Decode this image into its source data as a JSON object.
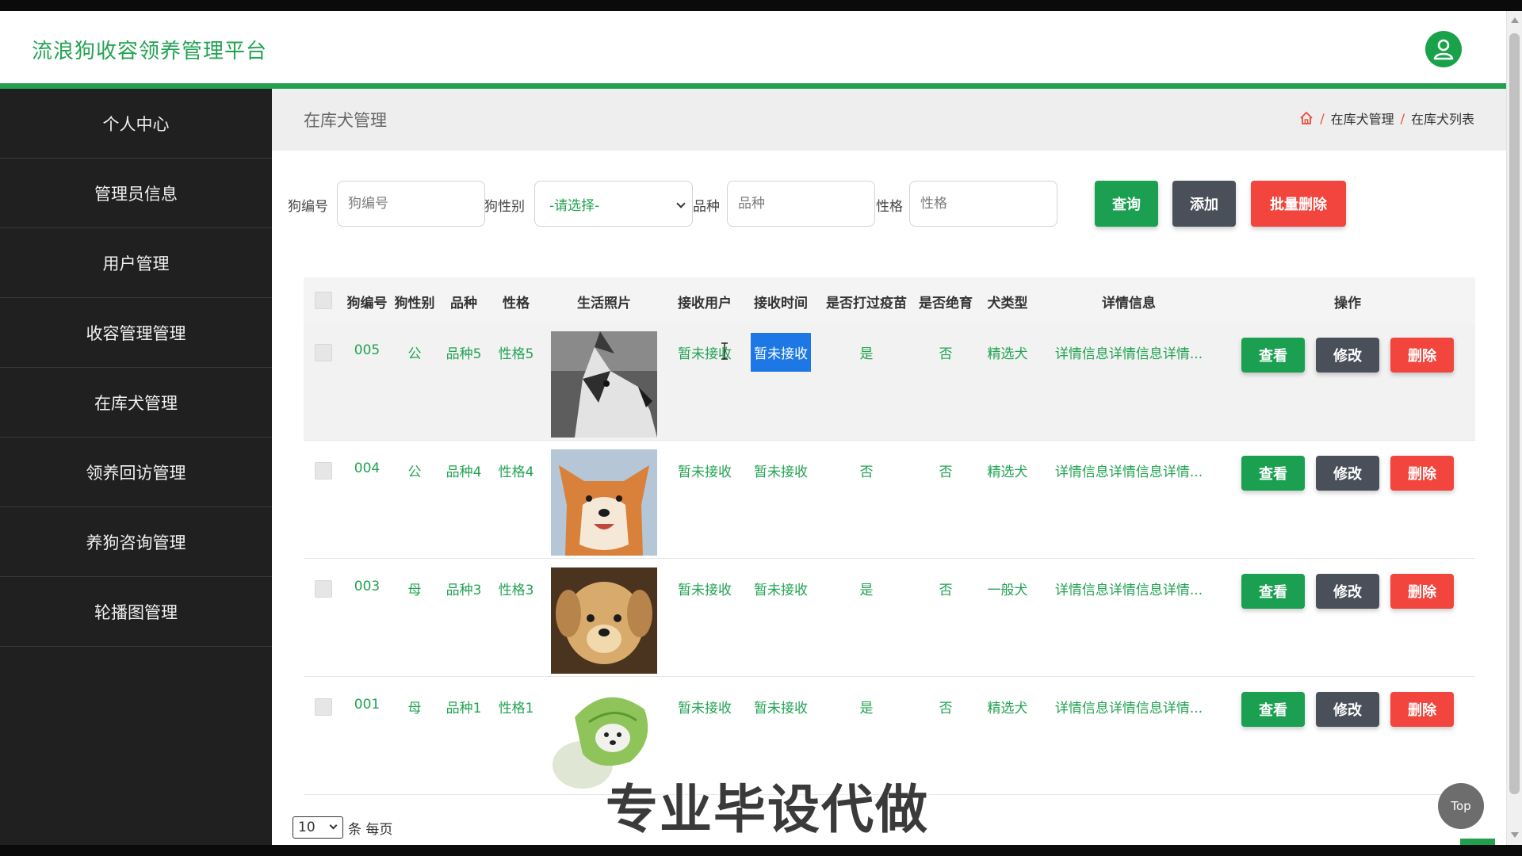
{
  "brand": "流浪狗收容领养管理平台",
  "sidebar": {
    "items": [
      {
        "label": "个人中心"
      },
      {
        "label": "管理员信息"
      },
      {
        "label": "用户管理"
      },
      {
        "label": "收容管理管理"
      },
      {
        "label": "在库犬管理"
      },
      {
        "label": "领养回访管理"
      },
      {
        "label": "养狗咨询管理"
      },
      {
        "label": "轮播图管理"
      }
    ]
  },
  "page": {
    "title": "在库犬管理",
    "breadcrumb": [
      "在库犬管理",
      "在库犬列表"
    ],
    "breadcrumb_sep": "/"
  },
  "filters": {
    "dog_no_label": "狗编号",
    "dog_no_placeholder": "狗编号",
    "sex_label": "狗性别",
    "sex_selected": "-请选择-",
    "breed_label": "品种",
    "breed_placeholder": "品种",
    "temper_label": "性格",
    "temper_placeholder": "性格"
  },
  "toolbar": {
    "query": "查询",
    "add": "添加",
    "batch_delete": "批量删除"
  },
  "table": {
    "headers": [
      "狗编号",
      "狗性别",
      "品种",
      "性格",
      "生活照片",
      "接收用户",
      "接收时间",
      "是否打过疫苗",
      "是否绝育",
      "犬类型",
      "详情信息",
      "操作"
    ],
    "rows": [
      {
        "no": "005",
        "sex": "公",
        "breed": "品种5",
        "temper": "性格5",
        "photo": "husky",
        "user": "暂未接收",
        "time": "暂未接收",
        "vaccine": "是",
        "neutered": "否",
        "type": "精选犬",
        "detail": "详情信息详情信息详情..."
      },
      {
        "no": "004",
        "sex": "公",
        "breed": "品种4",
        "temper": "性格4",
        "photo": "shiba",
        "user": "暂未接收",
        "time": "暂未接收",
        "vaccine": "否",
        "neutered": "否",
        "type": "精选犬",
        "detail": "详情信息详情信息详情..."
      },
      {
        "no": "003",
        "sex": "母",
        "breed": "品种3",
        "temper": "性格3",
        "photo": "puppy",
        "user": "暂未接收",
        "time": "暂未接收",
        "vaccine": "是",
        "neutered": "否",
        "type": "一般犬",
        "detail": "详情信息详情信息详情..."
      },
      {
        "no": "001",
        "sex": "母",
        "breed": "品种1",
        "temper": "性格1",
        "photo": "cabbage-dog",
        "user": "暂未接收",
        "time": "暂未接收",
        "vaccine": "是",
        "neutered": "否",
        "type": "精选犬",
        "detail": "详情信息详情信息详情..."
      }
    ],
    "actions": {
      "view": "查看",
      "edit": "修改",
      "delete": "删除"
    }
  },
  "pager": {
    "page_size": "10",
    "suffix": "条 每页"
  },
  "watermark": "专业毕设代做",
  "top_button": "Top",
  "colors": {
    "accent_green": "#22a352",
    "dark_button": "#4a505a",
    "danger": "#f2453d",
    "sidebar_bg": "#202020",
    "selection": "#1d78e6"
  },
  "icons": {
    "avatar": "user-icon",
    "breadcrumb_home": "home-icon"
  }
}
